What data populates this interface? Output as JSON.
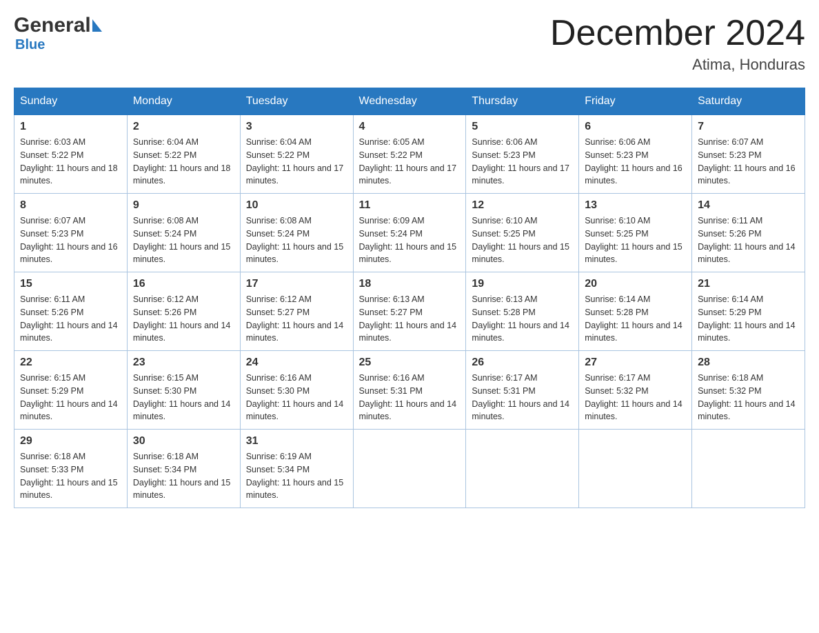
{
  "header": {
    "logo_general": "General",
    "logo_blue": "Blue",
    "month_title": "December 2024",
    "location": "Atima, Honduras"
  },
  "columns": [
    "Sunday",
    "Monday",
    "Tuesday",
    "Wednesday",
    "Thursday",
    "Friday",
    "Saturday"
  ],
  "weeks": [
    [
      {
        "day": "1",
        "sunrise": "Sunrise: 6:03 AM",
        "sunset": "Sunset: 5:22 PM",
        "daylight": "Daylight: 11 hours and 18 minutes."
      },
      {
        "day": "2",
        "sunrise": "Sunrise: 6:04 AM",
        "sunset": "Sunset: 5:22 PM",
        "daylight": "Daylight: 11 hours and 18 minutes."
      },
      {
        "day": "3",
        "sunrise": "Sunrise: 6:04 AM",
        "sunset": "Sunset: 5:22 PM",
        "daylight": "Daylight: 11 hours and 17 minutes."
      },
      {
        "day": "4",
        "sunrise": "Sunrise: 6:05 AM",
        "sunset": "Sunset: 5:22 PM",
        "daylight": "Daylight: 11 hours and 17 minutes."
      },
      {
        "day": "5",
        "sunrise": "Sunrise: 6:06 AM",
        "sunset": "Sunset: 5:23 PM",
        "daylight": "Daylight: 11 hours and 17 minutes."
      },
      {
        "day": "6",
        "sunrise": "Sunrise: 6:06 AM",
        "sunset": "Sunset: 5:23 PM",
        "daylight": "Daylight: 11 hours and 16 minutes."
      },
      {
        "day": "7",
        "sunrise": "Sunrise: 6:07 AM",
        "sunset": "Sunset: 5:23 PM",
        "daylight": "Daylight: 11 hours and 16 minutes."
      }
    ],
    [
      {
        "day": "8",
        "sunrise": "Sunrise: 6:07 AM",
        "sunset": "Sunset: 5:23 PM",
        "daylight": "Daylight: 11 hours and 16 minutes."
      },
      {
        "day": "9",
        "sunrise": "Sunrise: 6:08 AM",
        "sunset": "Sunset: 5:24 PM",
        "daylight": "Daylight: 11 hours and 15 minutes."
      },
      {
        "day": "10",
        "sunrise": "Sunrise: 6:08 AM",
        "sunset": "Sunset: 5:24 PM",
        "daylight": "Daylight: 11 hours and 15 minutes."
      },
      {
        "day": "11",
        "sunrise": "Sunrise: 6:09 AM",
        "sunset": "Sunset: 5:24 PM",
        "daylight": "Daylight: 11 hours and 15 minutes."
      },
      {
        "day": "12",
        "sunrise": "Sunrise: 6:10 AM",
        "sunset": "Sunset: 5:25 PM",
        "daylight": "Daylight: 11 hours and 15 minutes."
      },
      {
        "day": "13",
        "sunrise": "Sunrise: 6:10 AM",
        "sunset": "Sunset: 5:25 PM",
        "daylight": "Daylight: 11 hours and 15 minutes."
      },
      {
        "day": "14",
        "sunrise": "Sunrise: 6:11 AM",
        "sunset": "Sunset: 5:26 PM",
        "daylight": "Daylight: 11 hours and 14 minutes."
      }
    ],
    [
      {
        "day": "15",
        "sunrise": "Sunrise: 6:11 AM",
        "sunset": "Sunset: 5:26 PM",
        "daylight": "Daylight: 11 hours and 14 minutes."
      },
      {
        "day": "16",
        "sunrise": "Sunrise: 6:12 AM",
        "sunset": "Sunset: 5:26 PM",
        "daylight": "Daylight: 11 hours and 14 minutes."
      },
      {
        "day": "17",
        "sunrise": "Sunrise: 6:12 AM",
        "sunset": "Sunset: 5:27 PM",
        "daylight": "Daylight: 11 hours and 14 minutes."
      },
      {
        "day": "18",
        "sunrise": "Sunrise: 6:13 AM",
        "sunset": "Sunset: 5:27 PM",
        "daylight": "Daylight: 11 hours and 14 minutes."
      },
      {
        "day": "19",
        "sunrise": "Sunrise: 6:13 AM",
        "sunset": "Sunset: 5:28 PM",
        "daylight": "Daylight: 11 hours and 14 minutes."
      },
      {
        "day": "20",
        "sunrise": "Sunrise: 6:14 AM",
        "sunset": "Sunset: 5:28 PM",
        "daylight": "Daylight: 11 hours and 14 minutes."
      },
      {
        "day": "21",
        "sunrise": "Sunrise: 6:14 AM",
        "sunset": "Sunset: 5:29 PM",
        "daylight": "Daylight: 11 hours and 14 minutes."
      }
    ],
    [
      {
        "day": "22",
        "sunrise": "Sunrise: 6:15 AM",
        "sunset": "Sunset: 5:29 PM",
        "daylight": "Daylight: 11 hours and 14 minutes."
      },
      {
        "day": "23",
        "sunrise": "Sunrise: 6:15 AM",
        "sunset": "Sunset: 5:30 PM",
        "daylight": "Daylight: 11 hours and 14 minutes."
      },
      {
        "day": "24",
        "sunrise": "Sunrise: 6:16 AM",
        "sunset": "Sunset: 5:30 PM",
        "daylight": "Daylight: 11 hours and 14 minutes."
      },
      {
        "day": "25",
        "sunrise": "Sunrise: 6:16 AM",
        "sunset": "Sunset: 5:31 PM",
        "daylight": "Daylight: 11 hours and 14 minutes."
      },
      {
        "day": "26",
        "sunrise": "Sunrise: 6:17 AM",
        "sunset": "Sunset: 5:31 PM",
        "daylight": "Daylight: 11 hours and 14 minutes."
      },
      {
        "day": "27",
        "sunrise": "Sunrise: 6:17 AM",
        "sunset": "Sunset: 5:32 PM",
        "daylight": "Daylight: 11 hours and 14 minutes."
      },
      {
        "day": "28",
        "sunrise": "Sunrise: 6:18 AM",
        "sunset": "Sunset: 5:32 PM",
        "daylight": "Daylight: 11 hours and 14 minutes."
      }
    ],
    [
      {
        "day": "29",
        "sunrise": "Sunrise: 6:18 AM",
        "sunset": "Sunset: 5:33 PM",
        "daylight": "Daylight: 11 hours and 15 minutes."
      },
      {
        "day": "30",
        "sunrise": "Sunrise: 6:18 AM",
        "sunset": "Sunset: 5:34 PM",
        "daylight": "Daylight: 11 hours and 15 minutes."
      },
      {
        "day": "31",
        "sunrise": "Sunrise: 6:19 AM",
        "sunset": "Sunset: 5:34 PM",
        "daylight": "Daylight: 11 hours and 15 minutes."
      },
      null,
      null,
      null,
      null
    ]
  ]
}
